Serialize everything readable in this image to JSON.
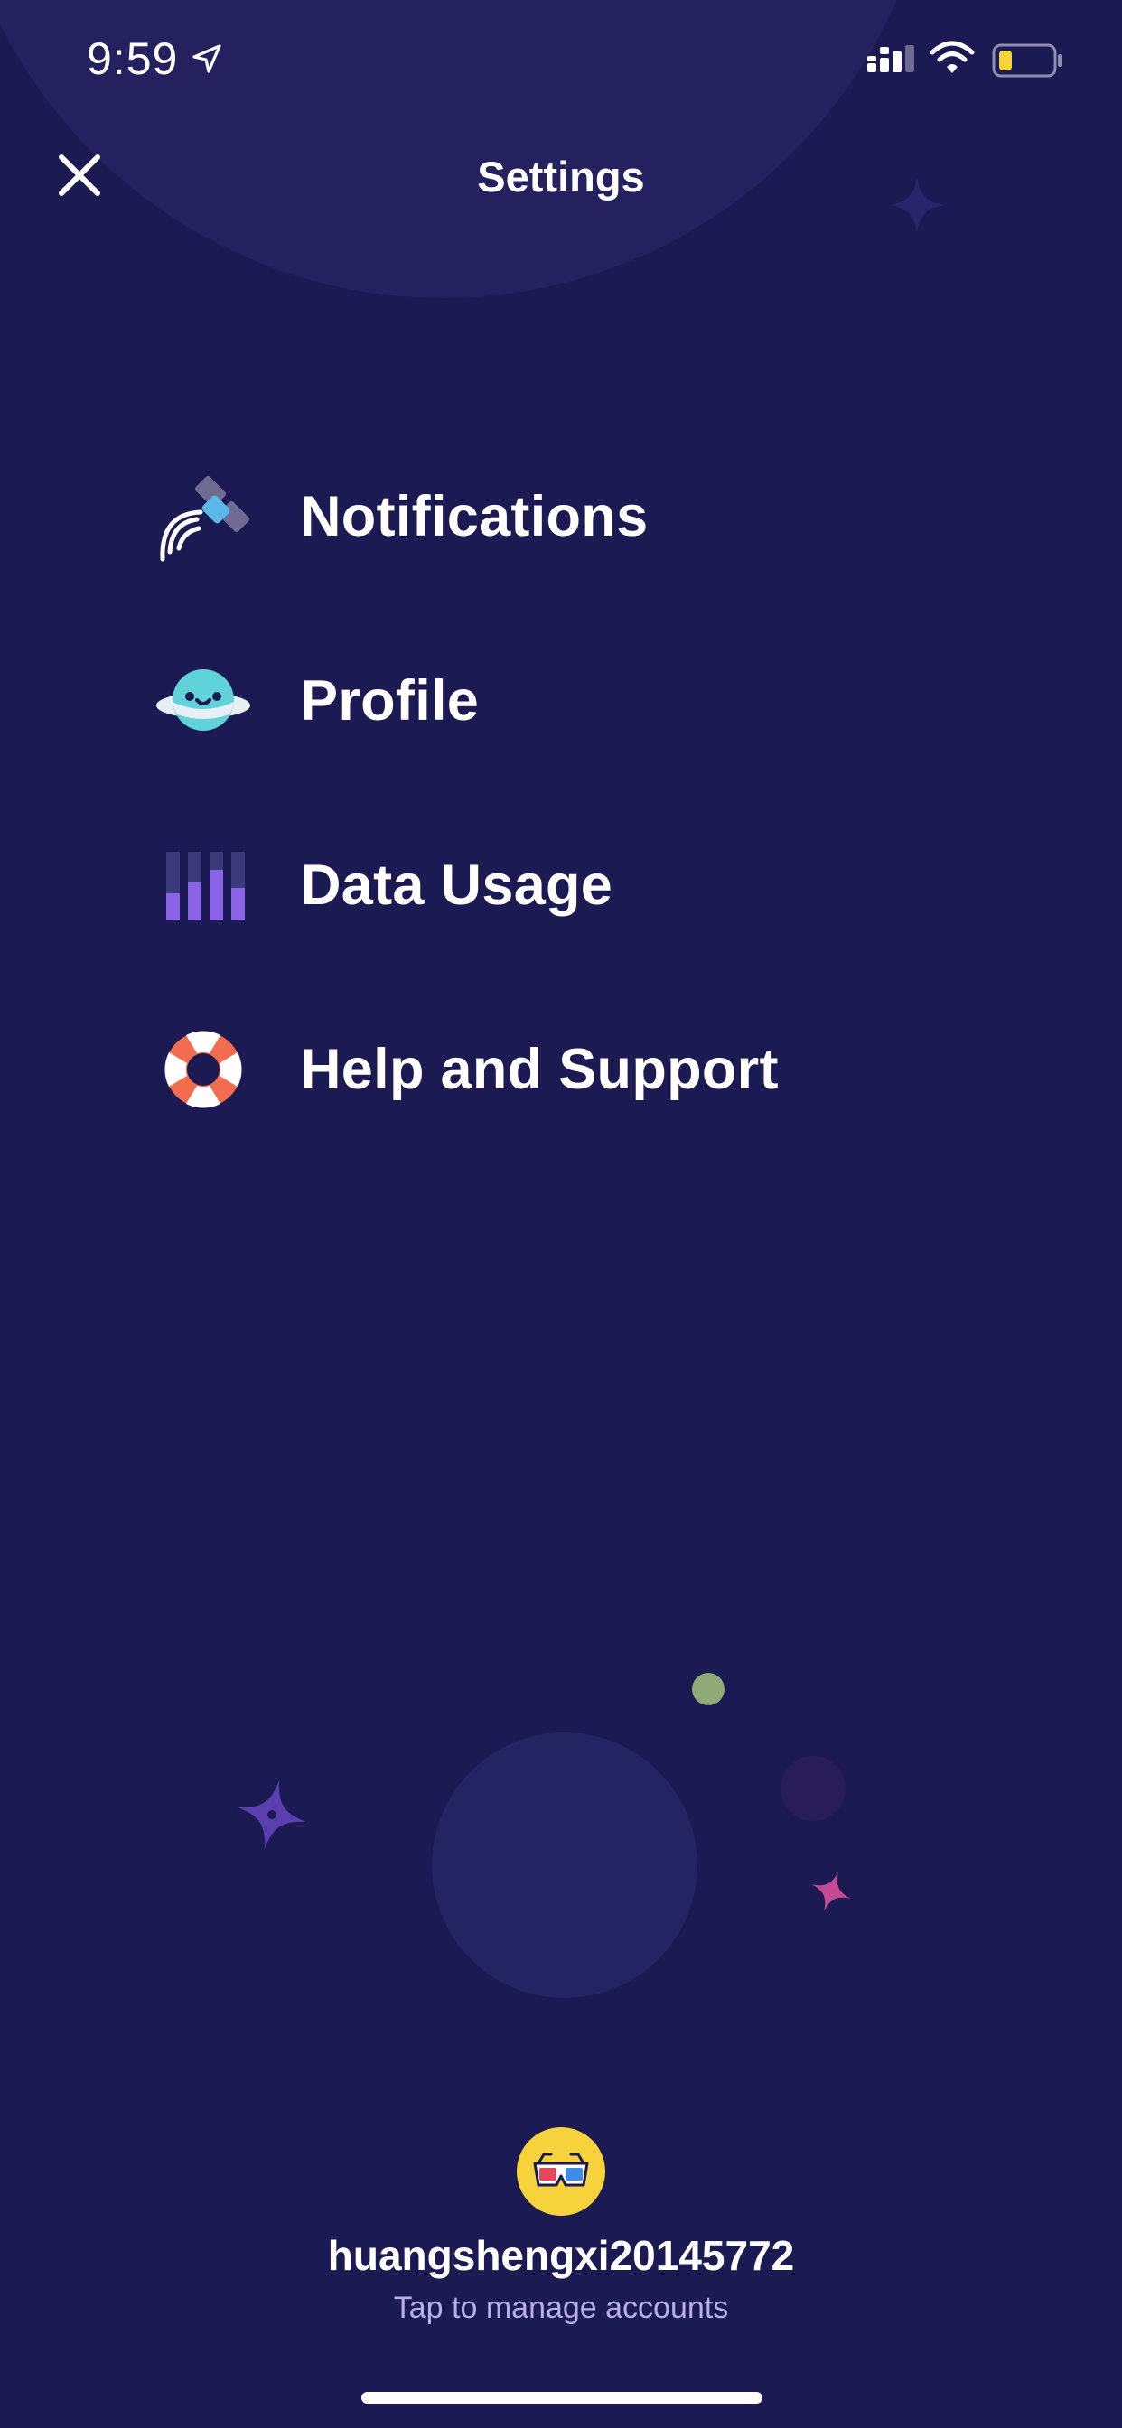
{
  "status_bar": {
    "time": "9:59",
    "location_icon": "location-arrow-icon",
    "signal_icon": "cellular-signal-icon",
    "wifi_icon": "wifi-icon",
    "battery_icon": "battery-low-icon",
    "battery_level": 0.2
  },
  "header": {
    "title": "Settings",
    "close_icon": "close-icon"
  },
  "menu": {
    "items": [
      {
        "label": "Notifications",
        "icon": "satellite-icon"
      },
      {
        "label": "Profile",
        "icon": "planet-face-icon"
      },
      {
        "label": "Data Usage",
        "icon": "bar-chart-icon"
      },
      {
        "label": "Help and Support",
        "icon": "life-ring-icon"
      }
    ]
  },
  "account": {
    "avatar_icon": "3d-glasses-icon",
    "username": "huangshengxi20145772",
    "manage_text": "Tap to manage accounts"
  },
  "colors": {
    "background": "#1c1a52",
    "accent_purple": "#7a5bd6",
    "accent_pink": "#c44b93",
    "avatar_yellow": "#f6d23b",
    "secondary_text": "#b7afe8"
  }
}
